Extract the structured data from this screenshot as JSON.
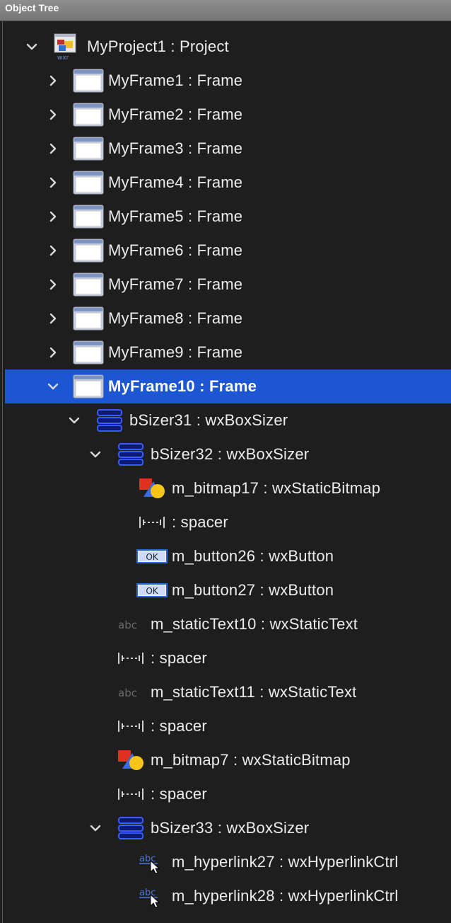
{
  "panel": {
    "title": "Object Tree"
  },
  "colors": {
    "selection": "#1d56d3",
    "background": "#1e1e1e",
    "text": "#ececec"
  },
  "tree": [
    {
      "label": "MyProject1 : Project",
      "icon": "project-icon",
      "expanded": true,
      "depth": 0
    },
    {
      "label": "MyFrame1 : Frame",
      "icon": "frame-icon",
      "expanded": false,
      "depth": 1
    },
    {
      "label": "MyFrame2 : Frame",
      "icon": "frame-icon",
      "expanded": false,
      "depth": 1
    },
    {
      "label": "MyFrame3 : Frame",
      "icon": "frame-icon",
      "expanded": false,
      "depth": 1
    },
    {
      "label": "MyFrame4 : Frame",
      "icon": "frame-icon",
      "expanded": false,
      "depth": 1
    },
    {
      "label": "MyFrame5 : Frame",
      "icon": "frame-icon",
      "expanded": false,
      "depth": 1
    },
    {
      "label": "MyFrame6 : Frame",
      "icon": "frame-icon",
      "expanded": false,
      "depth": 1
    },
    {
      "label": "MyFrame7 : Frame",
      "icon": "frame-icon",
      "expanded": false,
      "depth": 1
    },
    {
      "label": "MyFrame8 : Frame",
      "icon": "frame-icon",
      "expanded": false,
      "depth": 1
    },
    {
      "label": "MyFrame9 : Frame",
      "icon": "frame-icon",
      "expanded": false,
      "depth": 1
    },
    {
      "label": "MyFrame10 : Frame",
      "icon": "frame-icon",
      "expanded": true,
      "depth": 1,
      "selected": true
    },
    {
      "label": "bSizer31 : wxBoxSizer",
      "icon": "boxsizer-icon",
      "expanded": true,
      "depth": 2
    },
    {
      "label": "bSizer32 : wxBoxSizer",
      "icon": "boxsizer-icon",
      "expanded": true,
      "depth": 3
    },
    {
      "label": "m_bitmap17 : wxStaticBitmap",
      "icon": "bitmap-icon",
      "depth": 4
    },
    {
      "label": " : spacer",
      "icon": "spacer-icon",
      "depth": 4
    },
    {
      "label": "m_button26 : wxButton",
      "icon": "button-icon",
      "depth": 4
    },
    {
      "label": "m_button27 : wxButton",
      "icon": "button-icon",
      "depth": 4
    },
    {
      "label": "m_staticText10 : wxStaticText",
      "icon": "statictext-icon",
      "depth": 3
    },
    {
      "label": " : spacer",
      "icon": "spacer-icon",
      "depth": 3
    },
    {
      "label": "m_staticText11 : wxStaticText",
      "icon": "statictext-icon",
      "depth": 3
    },
    {
      "label": " : spacer",
      "icon": "spacer-icon",
      "depth": 3
    },
    {
      "label": "m_bitmap7 : wxStaticBitmap",
      "icon": "bitmap-icon",
      "depth": 3
    },
    {
      "label": " : spacer",
      "icon": "spacer-icon",
      "depth": 3
    },
    {
      "label": "bSizer33 : wxBoxSizer",
      "icon": "boxsizer-icon",
      "expanded": true,
      "depth": 3
    },
    {
      "label": "m_hyperlink27 : wxHyperlinkCtrl",
      "icon": "hyperlink-icon",
      "depth": 4
    },
    {
      "label": "m_hyperlink28 : wxHyperlinkCtrl",
      "icon": "hyperlink-icon",
      "depth": 4
    }
  ]
}
